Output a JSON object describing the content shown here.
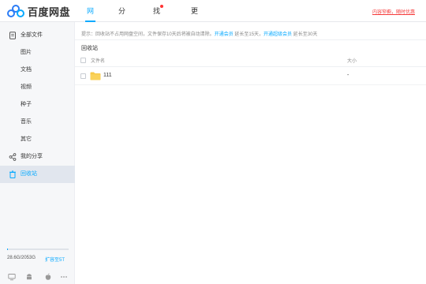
{
  "app": {
    "name": "百度网盘"
  },
  "nav": {
    "items": [
      {
        "label": "网盘"
      },
      {
        "label": "分享"
      },
      {
        "label": "找资源"
      },
      {
        "label": "更多"
      }
    ],
    "promo": "内容窄橱，随时优惠"
  },
  "sidebar": {
    "items": [
      {
        "label": "全部文件",
        "icon": "file-icon"
      },
      {
        "label": "图片"
      },
      {
        "label": "文档"
      },
      {
        "label": "视频"
      },
      {
        "label": "种子"
      },
      {
        "label": "音乐"
      },
      {
        "label": "其它"
      },
      {
        "label": "我的分享",
        "icon": "share-icon"
      },
      {
        "label": "回收站",
        "icon": "trash-icon"
      }
    ],
    "quota": {
      "used_text": "28.6G/2053G",
      "expand_link": "扩容至5T",
      "used_fraction": 0.014
    },
    "devices": [
      "monitor-icon",
      "android-icon",
      "apple-icon",
      "more-icon"
    ]
  },
  "main": {
    "tip": {
      "prefix": "提示：回收站不占用网盘空间，文件保存10天后将被自动清除。",
      "link1": "开通会员",
      "mid": " 延长至15天，",
      "link2": "开通超级会员",
      "suffix": " 延长至30天"
    },
    "breadcrumb": "回收站",
    "columns": {
      "name": "文件名",
      "size": "大小"
    },
    "rows": [
      {
        "name": "111",
        "size": "-"
      }
    ]
  },
  "colors": {
    "accent": "#09aaff",
    "sidebar_bg": "#f6f7f9",
    "promo": "#f53d3d",
    "folder": "#f7c948"
  }
}
